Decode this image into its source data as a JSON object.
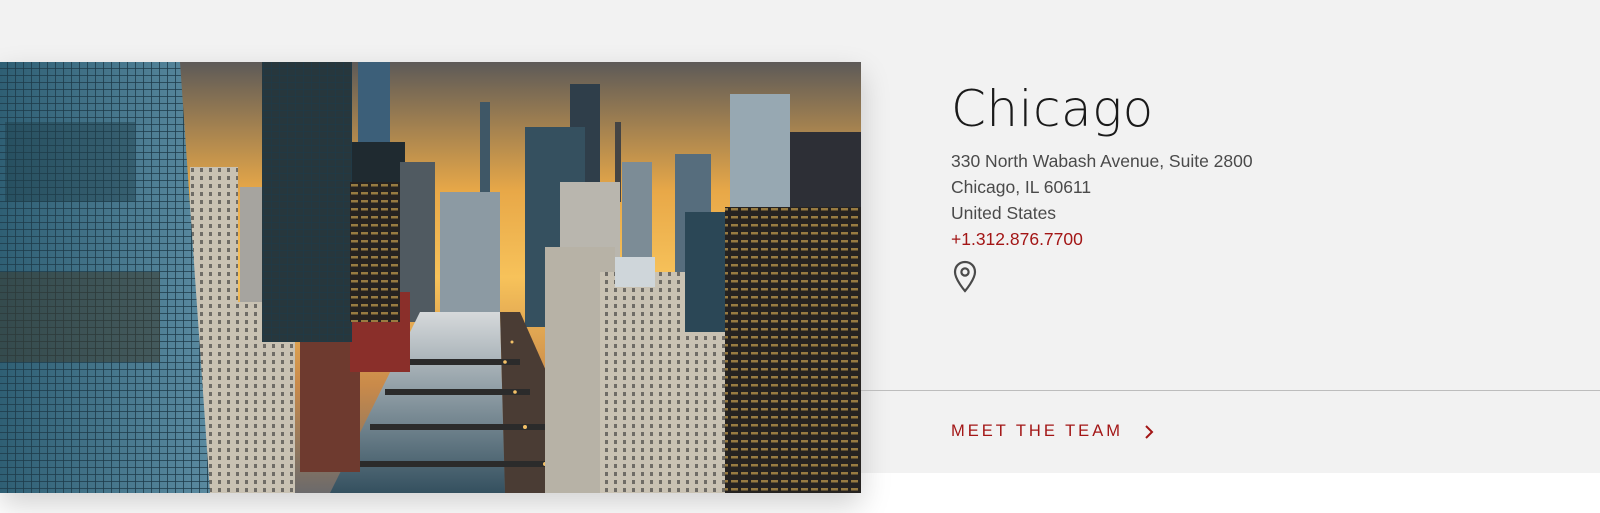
{
  "location": {
    "city": "Chicago",
    "address_line1": "330 North Wabash Avenue, Suite 2800",
    "address_line2": "Chicago, IL 60611",
    "country": "United States",
    "phone": "+1.312.876.7700"
  },
  "cta": {
    "label": "MEET THE TEAM"
  },
  "icons": {
    "map": "map-pin-icon",
    "cta": "chevron-right-icon"
  },
  "colors": {
    "accent": "#a31616",
    "band": "#f2f2f2"
  }
}
